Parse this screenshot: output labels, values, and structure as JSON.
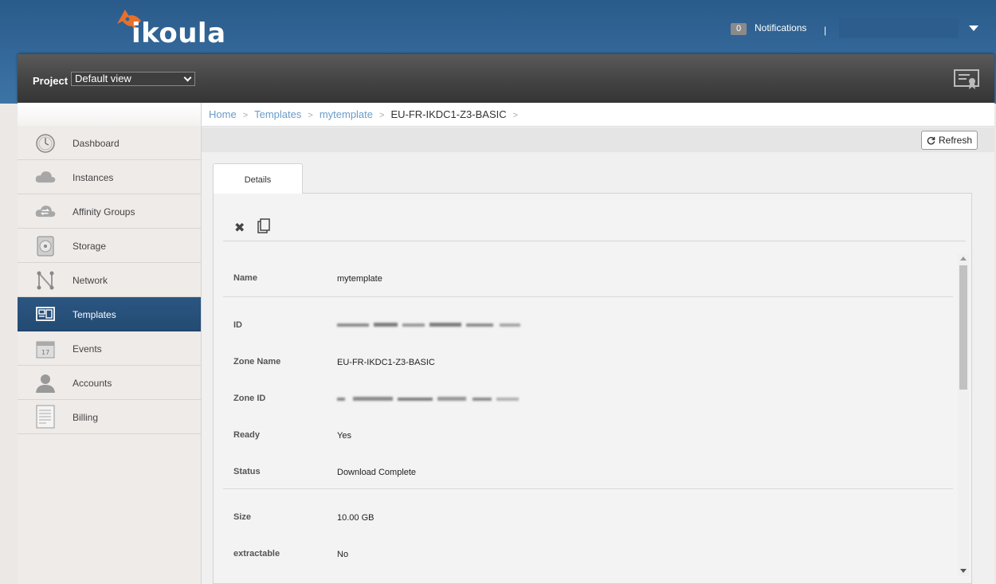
{
  "header": {
    "logo_text": "ikoula",
    "notifications_count": "0",
    "notifications_label": "Notifications",
    "divider": "|"
  },
  "project": {
    "label": "Project",
    "selected": "Default view"
  },
  "sidebar": {
    "items": [
      {
        "label": "Dashboard",
        "icon": "dashboard-gauge-icon"
      },
      {
        "label": "Instances",
        "icon": "cloud-icon"
      },
      {
        "label": "Affinity Groups",
        "icon": "cloud-arrows-icon"
      },
      {
        "label": "Storage",
        "icon": "disk-icon"
      },
      {
        "label": "Network",
        "icon": "network-icon"
      },
      {
        "label": "Templates",
        "icon": "templates-icon"
      },
      {
        "label": "Events",
        "icon": "calendar-icon"
      },
      {
        "label": "Accounts",
        "icon": "user-icon"
      },
      {
        "label": "Billing",
        "icon": "billing-document-icon"
      }
    ],
    "active": "Templates"
  },
  "breadcrumb": [
    "Home",
    "Templates",
    "mytemplate",
    "EU-FR-IKDC1-Z3-BASIC"
  ],
  "breadcrumb_sep": ">",
  "toolbar": {
    "refresh_label": "Refresh"
  },
  "tabs": [
    {
      "label": "Details"
    }
  ],
  "details": {
    "name": {
      "key": "Name",
      "value": "mytemplate"
    },
    "id": {
      "key": "ID"
    },
    "zone_name": {
      "key": "Zone Name",
      "value": "EU-FR-IKDC1-Z3-BASIC"
    },
    "zone_id": {
      "key": "Zone ID"
    },
    "ready": {
      "key": "Ready",
      "value": "Yes"
    },
    "status": {
      "key": "Status",
      "value": "Download Complete"
    },
    "size": {
      "key": "Size",
      "value": "10.00 GB"
    },
    "extractable": {
      "key": "extractable",
      "value": "No"
    }
  },
  "colors": {
    "header_blue": "#2f6294",
    "active_nav": "#264f79",
    "link": "#6a9cc8",
    "logo_orange": "#e8702a"
  }
}
